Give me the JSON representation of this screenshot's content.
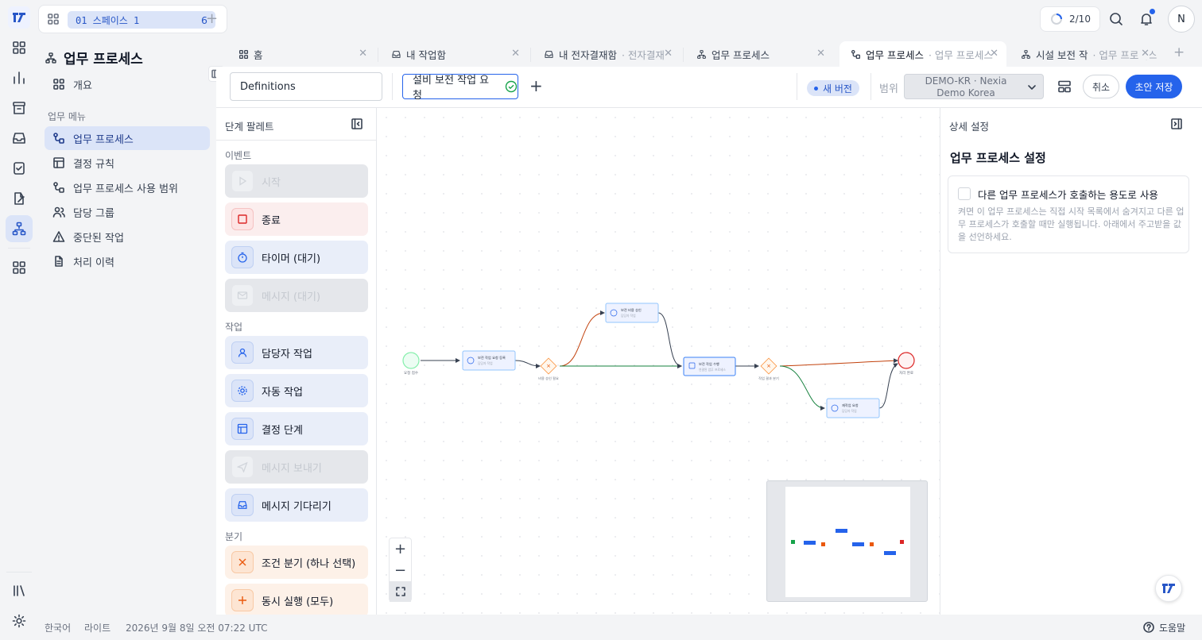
{
  "workspace": {
    "space_label": "01 스페이스 1",
    "space_count": "6",
    "progress": "2/10",
    "user_initial": "N"
  },
  "sidebar": {
    "title": "업무 프로세스",
    "overview": "개요",
    "section": "업무 메뉴",
    "items": [
      {
        "label": "업무 프로세스",
        "icon": "flow-icon"
      },
      {
        "label": "결정 규칙",
        "icon": "table-icon"
      },
      {
        "label": "업무 프로세스 사용 범위",
        "icon": "flow-icon"
      },
      {
        "label": "담당 그룹",
        "icon": "users-icon"
      },
      {
        "label": "중단된 작업",
        "icon": "warning-icon"
      },
      {
        "label": "처리 이력",
        "icon": "document-icon"
      }
    ]
  },
  "tabs": [
    {
      "label": "홈",
      "sub": ""
    },
    {
      "label": "내 작업함",
      "sub": ""
    },
    {
      "label": "내 전자결재함",
      "sub": "· 전자결재"
    },
    {
      "label": "업무 프로세스",
      "sub": ""
    },
    {
      "label": "업무 프로세스",
      "sub": "· 업무 프로세스"
    },
    {
      "label": "시설 보전 작",
      "sub": "· 업무 프로세스"
    }
  ],
  "toolbar": {
    "definitions": "Definitions",
    "process_name": "설비 보전 작업 요청",
    "version_badge": "새 버전",
    "scope_label": "범위",
    "scope_value_1": "DEMO-KR · Nexia",
    "scope_value_2": "Demo Korea",
    "cancel": "취소",
    "save": "초안 저장"
  },
  "palette": {
    "title": "단계 팔레트",
    "sections": {
      "events": "이벤트",
      "tasks": "작업",
      "gateways": "분기"
    },
    "events": [
      {
        "label": "시작",
        "disabled": true
      },
      {
        "label": "종료",
        "disabled": false
      },
      {
        "label": "타이머 (대기)",
        "disabled": false
      },
      {
        "label": "메시지 (대기)",
        "disabled": true
      }
    ],
    "tasks": [
      {
        "label": "담당자 작업",
        "disabled": false
      },
      {
        "label": "자동 작업",
        "disabled": false
      },
      {
        "label": "결정 단계",
        "disabled": false
      },
      {
        "label": "메시지 보내기",
        "disabled": true
      },
      {
        "label": "메시지 기다리기",
        "disabled": false
      }
    ],
    "gateways": [
      {
        "label": "조건 분기 (하나 선택)",
        "disabled": false
      },
      {
        "label": "동시 실행 (모두)",
        "disabled": false
      }
    ]
  },
  "diagram": {
    "start_label": "요청 접수",
    "task_register": "보전 작업 요청 등록",
    "task_register_sub": "담당자 작업",
    "gw1_label": "비용 승인 필요",
    "task_approve": "보전 비용 승인",
    "task_approve_sub": "담당자 작업",
    "task_execute": "보전 작업 수행",
    "task_execute_sub": "연결된 업무 프로세스",
    "gw2_label": "작업 결과 분기",
    "task_rework": "재작업 요청",
    "task_rework_sub": "담당자 작업",
    "end_label": "처리 완료"
  },
  "details": {
    "title": "상세 설정",
    "heading": "업무 프로세스 설정",
    "checkbox_label": "다른 업무 프로세스가 호출하는 용도로 사용",
    "description": "켜면 이 업무 프로세스는 직접 시작 목록에서 숨겨지고 다른 업무 프로세스가 호출할 때만 실행됩니다. 아래에서 주고받을 값을 선언하세요."
  },
  "footer": {
    "language": "한국어",
    "theme": "라이트",
    "datetime": "2026년 9월 8일 오전 07:22 UTC",
    "help": "도움말"
  },
  "colors": {
    "accent": "#2563eb",
    "active_bg": "#dbe4f8",
    "end_red": "#dc2626",
    "gateway_orange": "#ea580c",
    "start_green": "#16a34a"
  }
}
